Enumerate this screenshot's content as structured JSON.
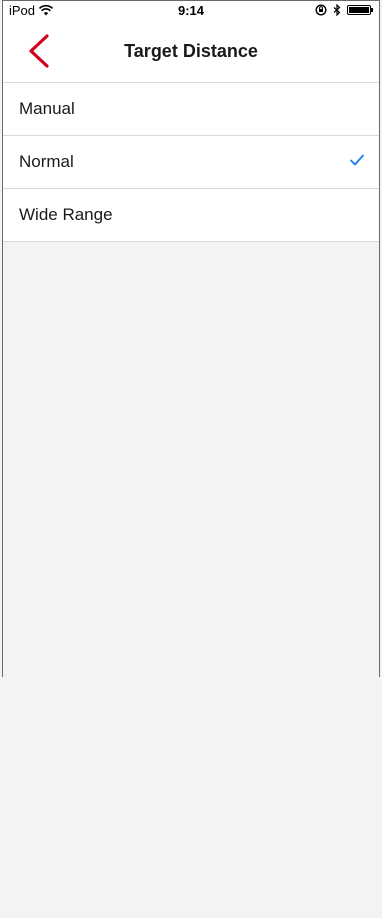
{
  "status_bar": {
    "carrier": "iPod",
    "time": "9:14"
  },
  "nav": {
    "title": "Target Distance",
    "back_icon": "chevron-left-icon",
    "accent_color": "#d0021b"
  },
  "options": [
    {
      "label": "Manual",
      "selected": false
    },
    {
      "label": "Normal",
      "selected": true
    },
    {
      "label": "Wide Range",
      "selected": false
    }
  ],
  "check_color": "#1a7cf5"
}
